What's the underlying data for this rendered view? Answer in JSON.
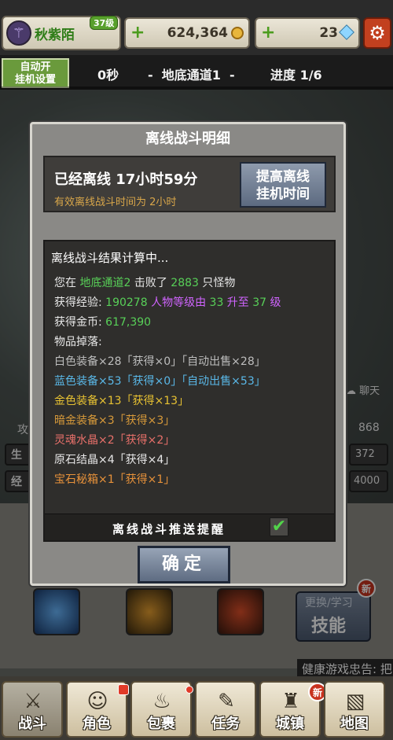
{
  "player": {
    "name": "秋紫陌",
    "level_badge": "37级"
  },
  "resources": {
    "gold": "624,364",
    "gems": "23"
  },
  "icons": {
    "settings": "gear-icon",
    "gold": "coin-icon",
    "gems": "gem-icon",
    "plus": "plus-icon",
    "avatar": "staff-icon"
  },
  "status": {
    "auto_button": [
      "自动开",
      "挂机设置"
    ],
    "timer": "0秒",
    "location": "-  地底通道1  -",
    "progress": "进度 1/6"
  },
  "background": {
    "chat": "聊天",
    "attack_prefix": "攻",
    "defense_value": "868",
    "hp_label": "生",
    "hp_value": "372",
    "exp_label": "经",
    "exp_value": "4000",
    "skill_button_sub": "更换/学习",
    "skill_button_label": "技能",
    "new_badge": "新",
    "health_notice": "健康游戏忠告: 把"
  },
  "modal": {
    "title": "离线战斗明细",
    "offline_time": "已经离线 17小时59分",
    "effective_time": "有效离线战斗时间为 2小时",
    "extend_button": [
      "提高离线",
      "挂机时间"
    ],
    "result_header": "离线战斗结果计算中...",
    "defeat": {
      "pre": "您在 ",
      "map": "地底通道2",
      "mid": " 击败了 ",
      "count": "2883",
      "post": " 只怪物"
    },
    "exp": {
      "label": "获得经验: ",
      "value": "190278",
      "t1": " 人物等级由 ",
      "from": "33",
      "t2": " 升至 ",
      "to": "37",
      "t3": " 级"
    },
    "gold": {
      "label": "获得金币: ",
      "value": "617,390"
    },
    "drops_label": "物品掉落:",
    "drops": [
      "白色装备×28「获得×0」「自动出售×28」",
      "蓝色装备×53「获得×0」「自动出售×53」",
      "金色装备×13「获得×13」",
      "暗金装备×3「获得×3」",
      "灵魂水晶×2「获得×2」",
      "原石结晶×4「获得×4」",
      "宝石秘箱×1「获得×1」"
    ],
    "notify_label": "离线战斗推送提醒",
    "notify_checked": true,
    "confirm": "确定"
  },
  "nav": [
    {
      "label": "战斗",
      "icon": "swords-icon"
    },
    {
      "label": "角色",
      "icon": "character-icon"
    },
    {
      "label": "包裹",
      "icon": "bag-icon"
    },
    {
      "label": "任务",
      "icon": "quest-icon"
    },
    {
      "label": "城镇",
      "icon": "town-icon"
    },
    {
      "label": "地图",
      "icon": "map-icon"
    }
  ],
  "colors": {
    "accent_green": "#58d058",
    "level_purple": "#d064ff",
    "blue_gear": "#5ab8e8",
    "gold_gear": "#e8c232",
    "warning_orange": "#d8a64a"
  }
}
